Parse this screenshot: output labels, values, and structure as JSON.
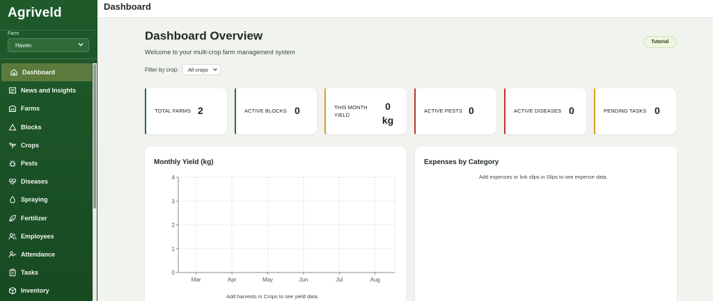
{
  "app": {
    "name": "Agriveld"
  },
  "sidebar": {
    "farm_label": "Farm",
    "farm_value": "Haven",
    "items": [
      {
        "label": "Dashboard",
        "icon": "home-icon",
        "active": true
      },
      {
        "label": "News and Insights",
        "icon": "newspaper-icon",
        "active": false
      },
      {
        "label": "Farms",
        "icon": "building-icon",
        "active": false
      },
      {
        "label": "Blocks",
        "icon": "triangle-icon",
        "active": false
      },
      {
        "label": "Crops",
        "icon": "sprout-icon",
        "active": false
      },
      {
        "label": "Pests",
        "icon": "bug-icon",
        "active": false
      },
      {
        "label": "Diseases",
        "icon": "heart-pulse-icon",
        "active": false
      },
      {
        "label": "Spraying",
        "icon": "spray-icon",
        "active": false
      },
      {
        "label": "Fertilizer",
        "icon": "leaf-icon",
        "active": false
      },
      {
        "label": "Employees",
        "icon": "users-icon",
        "active": false
      },
      {
        "label": "Attendance",
        "icon": "user-check-icon",
        "active": false
      },
      {
        "label": "Tasks",
        "icon": "clipboard-icon",
        "active": false
      },
      {
        "label": "Inventory",
        "icon": "box-icon",
        "active": false
      }
    ]
  },
  "topbar": {
    "title": "Dashboard"
  },
  "main": {
    "title": "Dashboard Overview",
    "subtitle": "Welcome to your multi-crop farm management system",
    "tutorial_label": "Tutorial",
    "filter_label": "Filter by crop:",
    "crop_filter_value": "All crops"
  },
  "stats": [
    {
      "label": "TOTAL FARMS",
      "value": "2",
      "color": "#2d6a35"
    },
    {
      "label": "ACTIVE BLOCKS",
      "value": "0",
      "color": "#2d6a35"
    },
    {
      "label": "THIS MONTH YIELD",
      "value": "0 kg",
      "value_num": "0",
      "unit": "kg",
      "color": "#d5a21a"
    },
    {
      "label": "ACTIVE PESTS",
      "value": "0",
      "color": "#c0312b"
    },
    {
      "label": "ACTIVE DISEASES",
      "value": "0",
      "color": "#c0312b"
    },
    {
      "label": "PENDING TASKS",
      "value": "0",
      "color": "#d5a21a"
    }
  ],
  "yield_panel": {
    "title": "Monthly Yield (kg)",
    "empty_note": "Add harvests in Crops to see yield data."
  },
  "expenses_panel": {
    "title": "Expenses by Category",
    "empty_note": "Add expenses or link slips in Slips to see expense data."
  },
  "chart_data": {
    "type": "line",
    "categories": [
      "Mar",
      "Apr",
      "May",
      "Jun",
      "Jul",
      "Aug"
    ],
    "series": [],
    "yticks": [
      0,
      1,
      2,
      3,
      4
    ],
    "ylim": [
      0,
      4
    ],
    "grid": true
  }
}
